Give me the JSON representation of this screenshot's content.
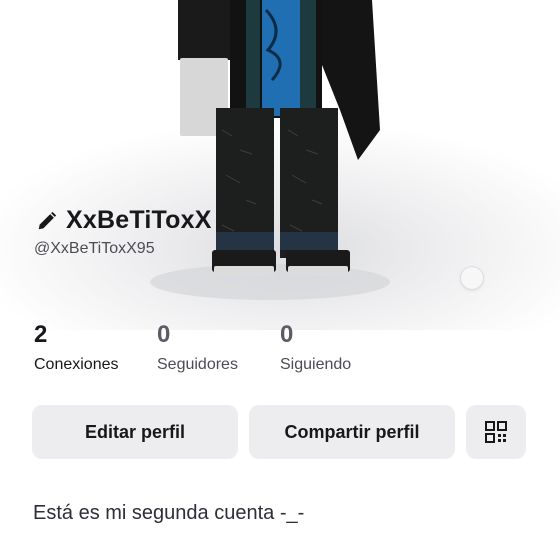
{
  "profile": {
    "display_name": "XxBeTiToxX",
    "username": "@XxBeTiToxX95",
    "bio": "Está es mi segunda cuenta -_-"
  },
  "stats": [
    {
      "count": "2",
      "label": "Conexiones"
    },
    {
      "count": "0",
      "label": "Seguidores"
    },
    {
      "count": "0",
      "label": "Siguiendo"
    }
  ],
  "actions": {
    "edit_label": "Editar perfil",
    "share_label": "Compartir perfil"
  },
  "icons": {
    "edit": "pencil-icon",
    "qr": "qr-code-icon"
  },
  "colors": {
    "button_bg": "#ededf0",
    "text_primary": "#17181c"
  }
}
